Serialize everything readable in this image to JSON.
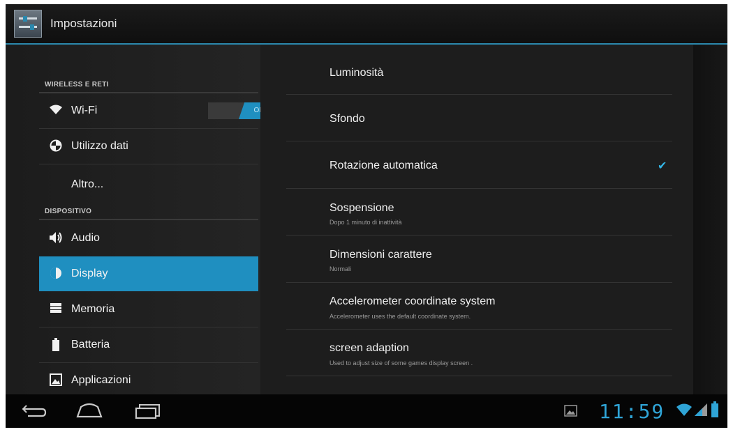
{
  "app": {
    "title": "Impostazioni",
    "icon": "settings-sliders-icon"
  },
  "sidebar": {
    "sections": [
      {
        "header": "WIRELESS E RETI",
        "items": [
          {
            "label": "Wi-Fi",
            "icon": "wifi-icon",
            "toggle": "ON"
          },
          {
            "label": "Utilizzo dati",
            "icon": "data-usage-icon"
          },
          {
            "label": "Altro...",
            "icon": ""
          }
        ]
      },
      {
        "header": "DISPOSITIVO",
        "items": [
          {
            "label": "Audio",
            "icon": "audio-icon"
          },
          {
            "label": "Display",
            "icon": "display-icon",
            "selected": true
          },
          {
            "label": "Memoria",
            "icon": "storage-icon"
          },
          {
            "label": "Batteria",
            "icon": "battery-icon"
          },
          {
            "label": "Applicazioni",
            "icon": "apps-icon"
          }
        ]
      }
    ]
  },
  "display_settings": [
    {
      "title": "Luminosità",
      "summary": ""
    },
    {
      "title": "Sfondo",
      "summary": ""
    },
    {
      "title": "Rotazione automatica",
      "summary": "",
      "checked": true
    },
    {
      "title": "Sospensione",
      "summary": "Dopo 1 minuto di inattività"
    },
    {
      "title": "Dimensioni carattere",
      "summary": "Normali"
    },
    {
      "title": "Accelerometer coordinate system",
      "summary": "Accelerometer uses the default coordinate system."
    },
    {
      "title": "screen adaption",
      "summary": "Used to adjust size of some games display screen ."
    }
  ],
  "navbar": {
    "buttons": [
      "back-icon",
      "home-icon",
      "recent-apps-icon"
    ],
    "clock": "11:59",
    "status_icons": [
      "gallery-notification-icon",
      "wifi-signal-icon",
      "cell-signal-icon",
      "battery-status-icon"
    ]
  },
  "colors": {
    "accent": "#1f8fc0",
    "clock": "#2fa4d6",
    "background": "#1d1d1d"
  }
}
